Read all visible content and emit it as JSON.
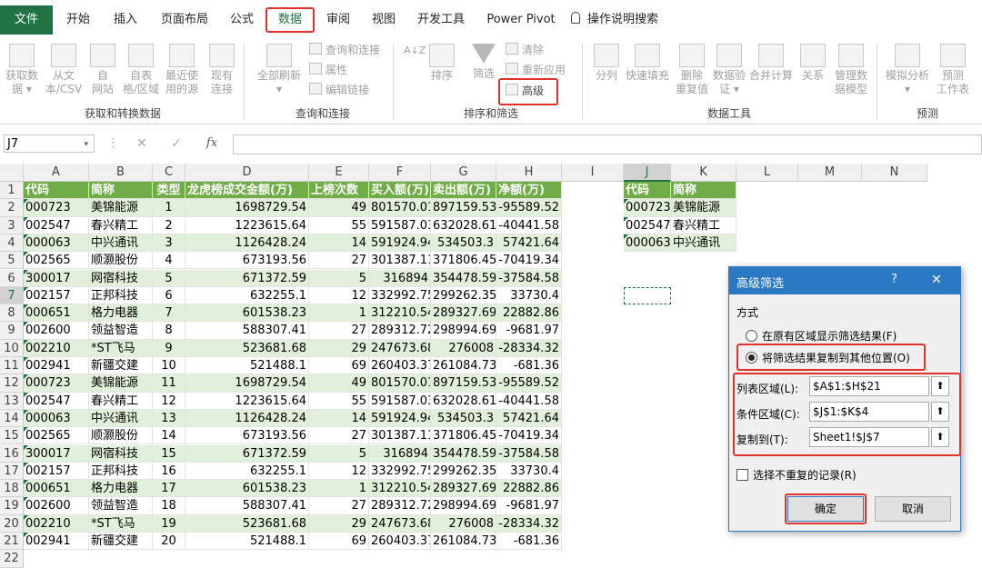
{
  "menu": {
    "tabs": [
      "文件",
      "开始",
      "插入",
      "页面布局",
      "公式",
      "数据",
      "审阅",
      "视图",
      "开发工具",
      "Power Pivot"
    ],
    "tellme": "操作说明搜索"
  },
  "ribbon": {
    "g1": {
      "label": "获取和转换数据",
      "btns": [
        [
          "获取数",
          "据 ▾"
        ],
        [
          "从文",
          "本/CSV"
        ],
        [
          "自",
          "网站"
        ],
        [
          "自表",
          "格/区域"
        ],
        [
          "最近使",
          "用的源"
        ],
        [
          "现有",
          "连接"
        ]
      ]
    },
    "g2": {
      "label": "查询和连接",
      "big": [
        "全部刷新",
        "▾"
      ],
      "small": [
        "查询和连接",
        "属性",
        "编辑链接"
      ]
    },
    "g3": {
      "label": "排序和筛选",
      "az": "A↓Z",
      "sort": "排序",
      "filter": "筛选",
      "small": [
        "清除",
        "重新应用",
        "高级"
      ]
    },
    "g4": {
      "label": "数据工具",
      "btns": [
        [
          "分列",
          ""
        ],
        [
          "快速填充",
          ""
        ],
        [
          "删除",
          "重复值"
        ],
        [
          "数据验",
          "证 ▾"
        ],
        [
          "合并计算",
          ""
        ],
        [
          "关系",
          ""
        ],
        [
          "管理数",
          "据模型"
        ]
      ]
    },
    "g5": {
      "label": "预测",
      "btns": [
        [
          "模拟分析",
          "▾"
        ],
        [
          "预测",
          "工作表"
        ]
      ]
    }
  },
  "formula_bar": {
    "name_box": "J7",
    "cancel": "✕",
    "enter": "✓",
    "fx": "fx"
  },
  "columns": [
    "A",
    "B",
    "C",
    "D",
    "E",
    "F",
    "G",
    "H",
    "I",
    "J",
    "K",
    "L",
    "M",
    "N"
  ],
  "headers": [
    "代码",
    "简称",
    "类型",
    "龙虎榜成交金额(万)",
    "上榜次数",
    "买入额(万)",
    "卖出额(万)",
    "净额(万)"
  ],
  "rows": [
    [
      "000723",
      "美锦能源",
      "1",
      "1698729.54",
      "49",
      "801570.01",
      "897159.53",
      "-95589.52"
    ],
    [
      "002547",
      "春兴精工",
      "2",
      "1223615.64",
      "55",
      "591587.03",
      "632028.61",
      "-40441.58"
    ],
    [
      "000063",
      "中兴通讯",
      "3",
      "1126428.24",
      "14",
      "591924.94",
      "534503.3",
      "57421.64"
    ],
    [
      "002565",
      "顺灏股份",
      "4",
      "673193.56",
      "27",
      "301387.11",
      "371806.45",
      "-70419.34"
    ],
    [
      "300017",
      "网宿科技",
      "5",
      "671372.59",
      "5",
      "316894",
      "354478.59",
      "-37584.58"
    ],
    [
      "002157",
      "正邦科技",
      "6",
      "632255.1",
      "12",
      "332992.75",
      "299262.35",
      "33730.4"
    ],
    [
      "000651",
      "格力电器",
      "7",
      "601538.23",
      "1",
      "312210.54",
      "289327.69",
      "22882.86"
    ],
    [
      "002600",
      "领益智造",
      "8",
      "588307.41",
      "27",
      "289312.72",
      "298994.69",
      "-9681.97"
    ],
    [
      "002210",
      "*ST飞马",
      "9",
      "523681.68",
      "29",
      "247673.68",
      "276008",
      "-28334.32"
    ],
    [
      "002941",
      "新疆交建",
      "10",
      "521488.1",
      "69",
      "260403.37",
      "261084.73",
      "-681.36"
    ],
    [
      "000723",
      "美锦能源",
      "11",
      "1698729.54",
      "49",
      "801570.01",
      "897159.53",
      "-95589.52"
    ],
    [
      "002547",
      "春兴精工",
      "12",
      "1223615.64",
      "55",
      "591587.03",
      "632028.61",
      "-40441.58"
    ],
    [
      "000063",
      "中兴通讯",
      "13",
      "1126428.24",
      "14",
      "591924.94",
      "534503.3",
      "57421.64"
    ],
    [
      "002565",
      "顺灏股份",
      "14",
      "673193.56",
      "27",
      "301387.11",
      "371806.45",
      "-70419.34"
    ],
    [
      "300017",
      "网宿科技",
      "15",
      "671372.59",
      "5",
      "316894",
      "354478.59",
      "-37584.58"
    ],
    [
      "002157",
      "正邦科技",
      "16",
      "632255.1",
      "12",
      "332992.75",
      "299262.35",
      "33730.4"
    ],
    [
      "000651",
      "格力电器",
      "17",
      "601538.23",
      "1",
      "312210.54",
      "289327.69",
      "22882.86"
    ],
    [
      "002600",
      "领益智造",
      "18",
      "588307.41",
      "27",
      "289312.72",
      "298994.69",
      "-9681.97"
    ],
    [
      "002210",
      "*ST飞马",
      "19",
      "523681.68",
      "29",
      "247673.68",
      "276008",
      "-28334.32"
    ],
    [
      "002941",
      "新疆交建",
      "20",
      "521488.1",
      "69",
      "260403.37",
      "261084.73",
      "-681.36"
    ]
  ],
  "criteria": {
    "headers": [
      "代码",
      "简称"
    ],
    "rows": [
      [
        "000723",
        "美锦能源"
      ],
      [
        "002547",
        "春兴精工"
      ],
      [
        "000063",
        "中兴通讯"
      ]
    ]
  },
  "dialog": {
    "title": "高级筛选",
    "help": "?",
    "close": "✕",
    "mode_label": "方式",
    "opt1": "在原有区域显示筛选结果(F)",
    "opt2": "将筛选结果复制到其他位置(O)",
    "list_label": "列表区域(L):",
    "list_value": "$A$1:$H$21",
    "crit_label": "条件区域(C):",
    "crit_value": "$J$1:$K$4",
    "copy_label": "复制到(T):",
    "copy_value": "Sheet1!$J$7",
    "unique": "选择不重复的记录(R)",
    "ok": "确定",
    "cancel": "取消"
  }
}
